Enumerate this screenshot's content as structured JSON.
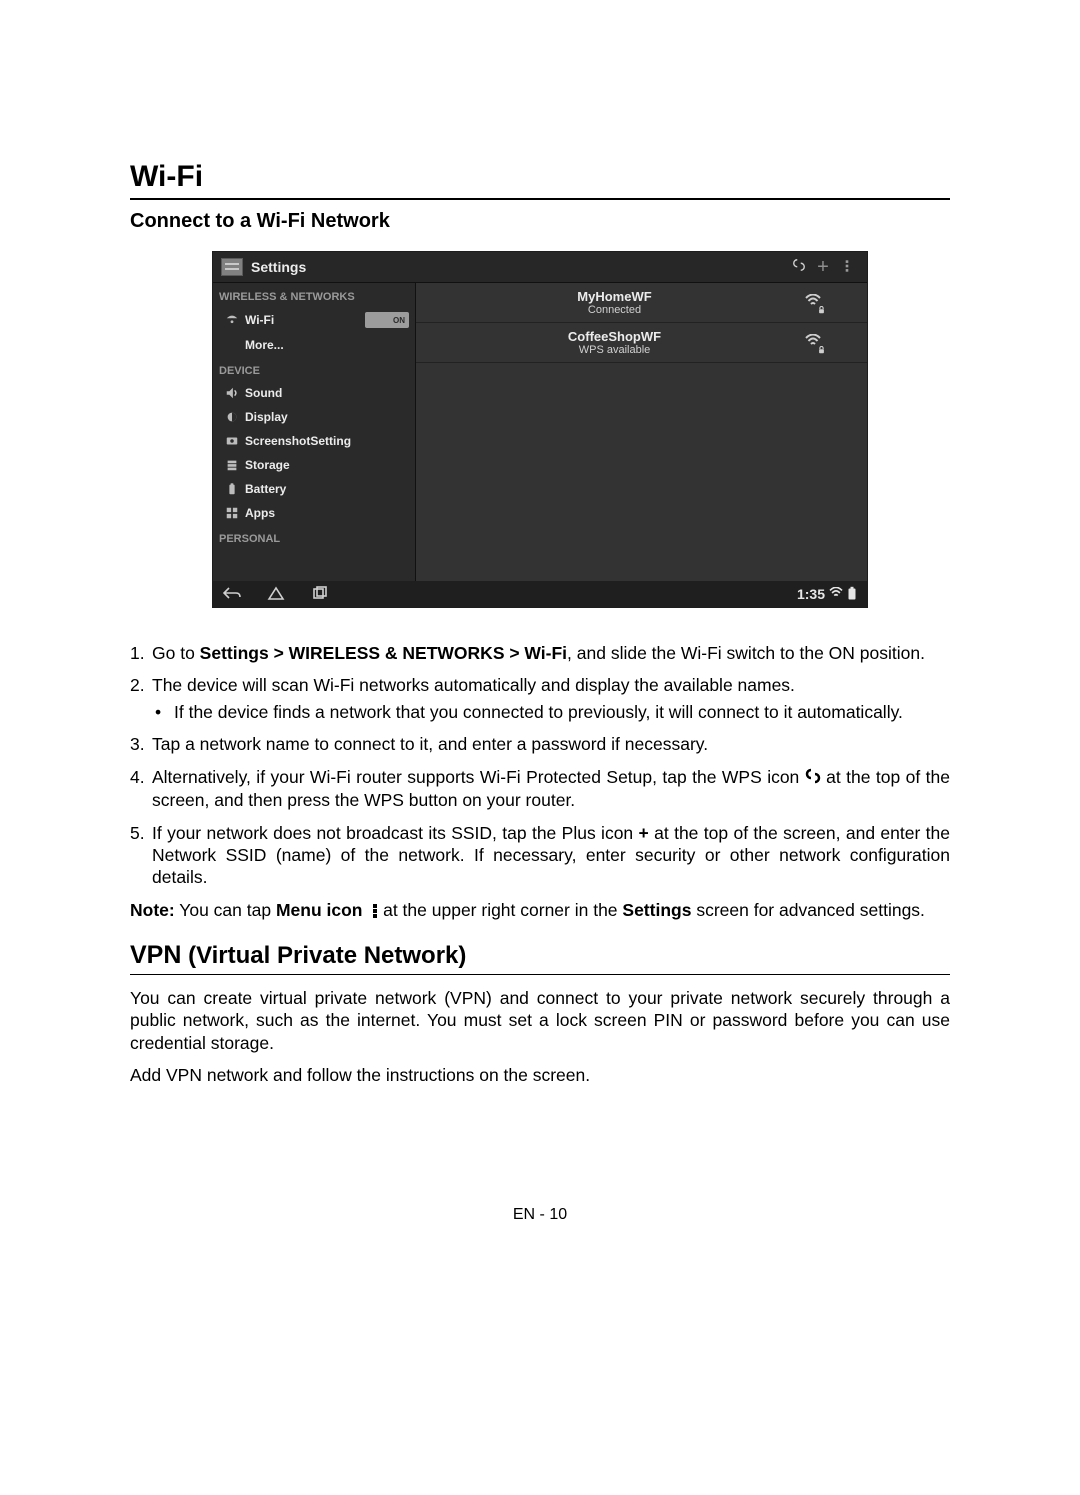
{
  "title": "Wi-Fi",
  "subtitle": "Connect to a Wi-Fi Network",
  "screenshot": {
    "titlebar": {
      "title": "Settings"
    },
    "sidebar": {
      "cat_wireless": "WIRELESS & NETWORKS",
      "wifi_label": "Wi-Fi",
      "wifi_toggle": "ON",
      "more_label": "More...",
      "cat_device": "DEVICE",
      "sound_label": "Sound",
      "display_label": "Display",
      "screenshot_label": "ScreenshotSetting",
      "storage_label": "Storage",
      "battery_label": "Battery",
      "apps_label": "Apps",
      "cat_personal": "PERSONAL"
    },
    "networks": {
      "n0": {
        "name": "MyHomeWF",
        "sub": "Connected"
      },
      "n1": {
        "name": "CoffeeShopWF",
        "sub": "WPS available"
      }
    },
    "bottombar": {
      "time": "1:35"
    }
  },
  "steps": {
    "s1a": "Go to ",
    "s1b": "Settings > WIRELESS & NETWORKS > Wi-Fi",
    "s1c": ", and slide the Wi-Fi switch to the ON position.",
    "s2": "The device will scan Wi-Fi networks automatically and display the available names.",
    "s2_sub": "If the device finds a network that you connected to previously, it will connect to it automatically.",
    "s3": "Tap a network name to connect to it, and enter a password if necessary.",
    "s4a": "Alternatively, if your Wi-Fi router supports Wi-Fi Protected Setup, tap the WPS icon ",
    "s4b": " at the top of the screen, and then press the WPS button on your router.",
    "s5a": "If your network does not broadcast its SSID, tap the Plus icon ",
    "s5b": "+",
    "s5c": " at the top of the screen, and enter the Network SSID (name) of the network. If necessary, enter security or other network configuration details."
  },
  "note": {
    "label": "Note:",
    "a": " You can tap ",
    "b": "Menu icon",
    "c": " at the upper right corner in the ",
    "d": "Settings",
    "e": " screen for advanced settings."
  },
  "vpn": {
    "heading_abbr": "VPN",
    "heading_rest": " (Virtual Private Network)",
    "p1": "You can create virtual private network (VPN) and connect to your private network securely through a public network, such as the internet. You must set a lock screen PIN or password before you can use credential storage.",
    "p2": "Add VPN network and follow the instructions on the screen."
  },
  "footer": "EN - 10"
}
